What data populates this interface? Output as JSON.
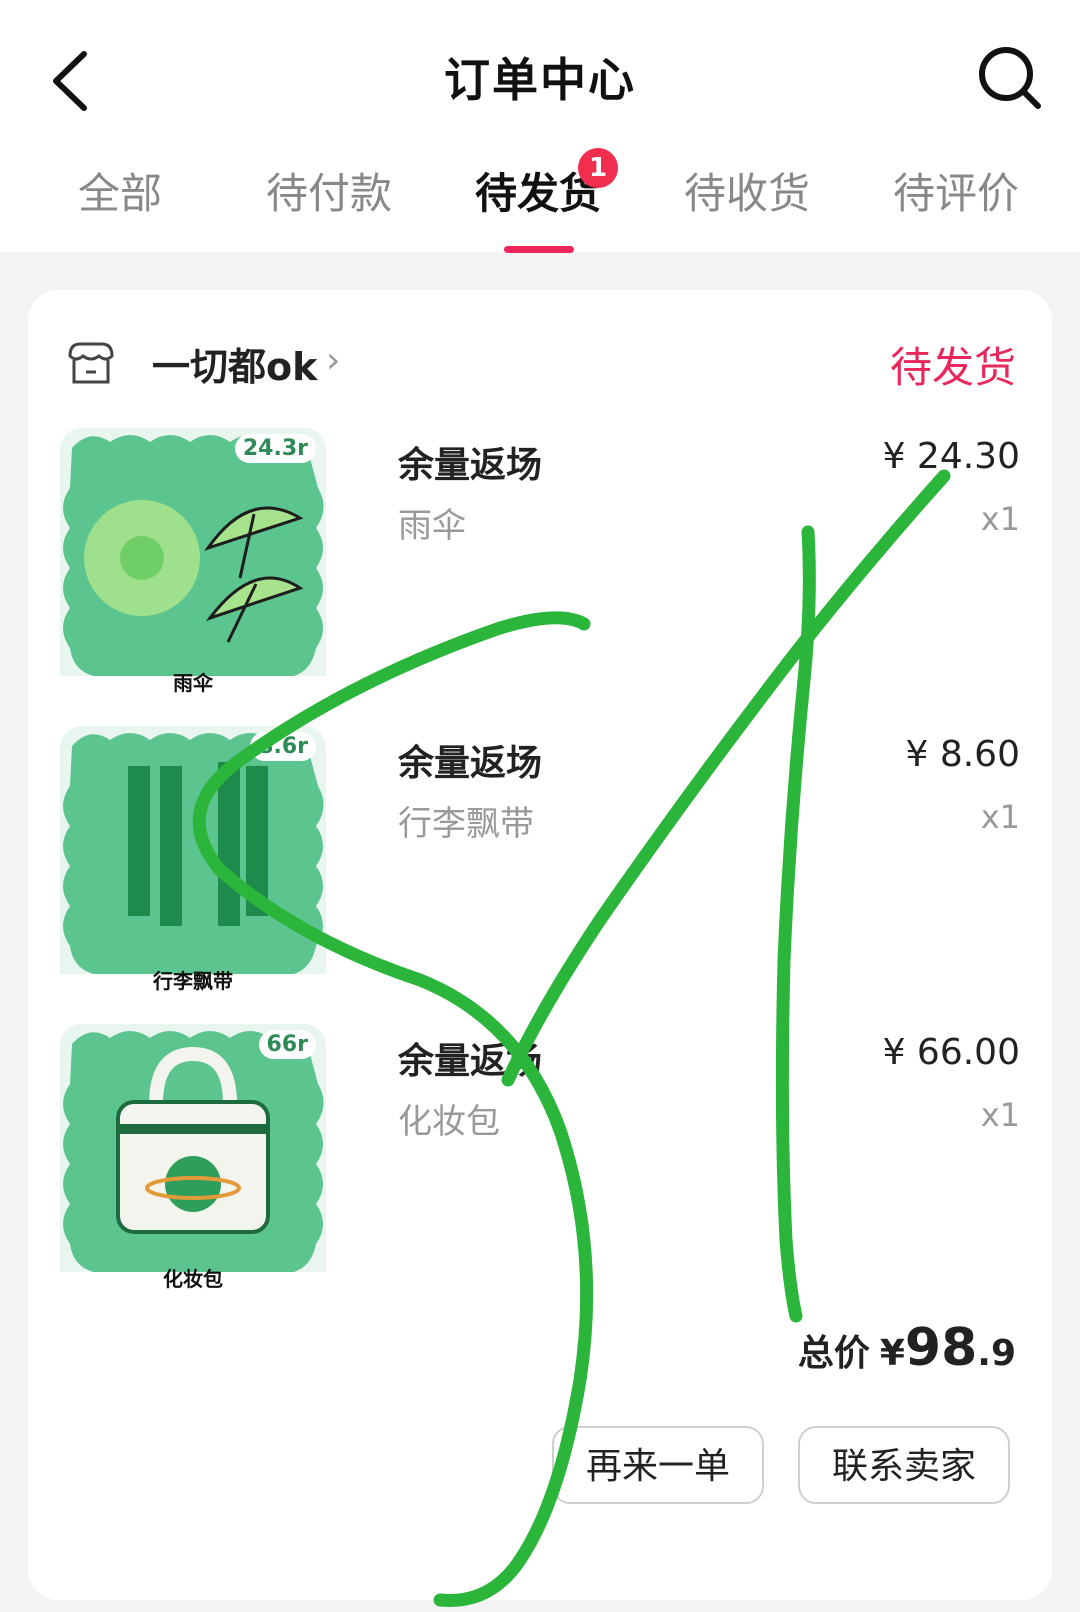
{
  "header": {
    "title": "订单中心",
    "back_icon": "back-arrow-icon",
    "search_icon": "search-icon"
  },
  "tabs": [
    {
      "label": "全部",
      "active": false
    },
    {
      "label": "待付款",
      "active": false
    },
    {
      "label": "待发货",
      "active": true,
      "badge": "1"
    },
    {
      "label": "待收货",
      "active": false
    },
    {
      "label": "待评价",
      "active": false
    }
  ],
  "order": {
    "store_name": "一切都ok",
    "store_icon": "store-icon",
    "status": "待发货",
    "items": [
      {
        "name": "余量返场",
        "spec": "雨伞",
        "price": "¥ 24.30",
        "qty": "x1",
        "thumb_tag": "24.3r",
        "thumb_caption": "雨伞"
      },
      {
        "name": "余量返场",
        "spec": "行李飘带",
        "price": "¥ 8.60",
        "qty": "x1",
        "thumb_tag": "8.6r",
        "thumb_caption": "行李飘带"
      },
      {
        "name": "余量返场",
        "spec": "化妆包",
        "price": "¥ 66.00",
        "qty": "x1",
        "thumb_tag": "66r",
        "thumb_caption": "化妆包"
      }
    ],
    "total": {
      "label": "总价",
      "currency": "¥",
      "integer": "98",
      "decimal": ".9"
    },
    "buttons": {
      "reorder": "再来一单",
      "contact": "联系卖家"
    }
  },
  "colors": {
    "accent": "#f0265a",
    "badge": "#f12e4d",
    "thumb_green": "#4fc08d",
    "scribble": "#2bb53a"
  }
}
